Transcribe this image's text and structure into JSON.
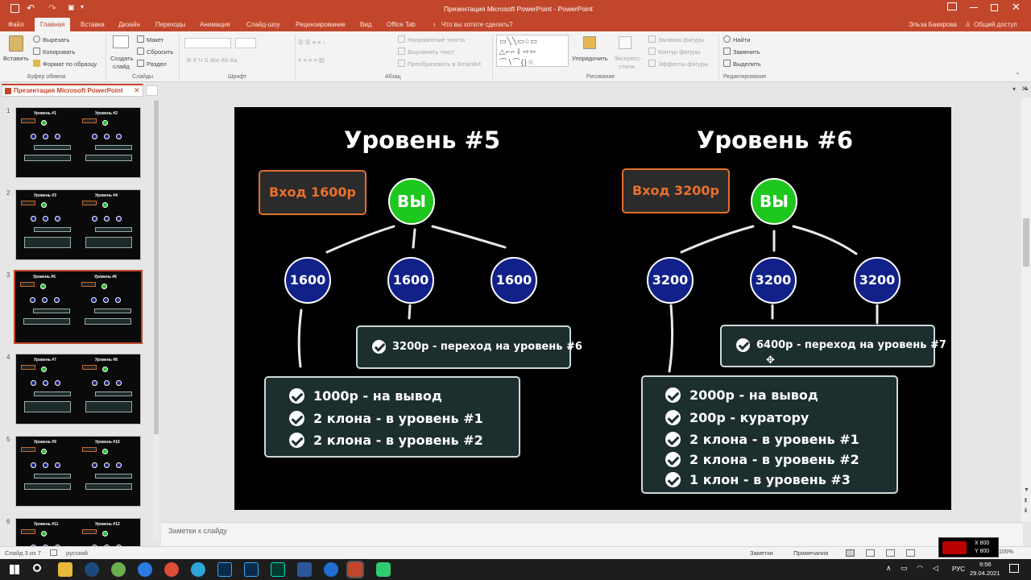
{
  "titlebar": {
    "title": "Презентация Microsoft PowerPoint - PowerPoint",
    "user": "Эльза Бакирова",
    "share": "Общий доступ"
  },
  "tabs": [
    "Файл",
    "Главная",
    "Вставка",
    "Дизайн",
    "Переходы",
    "Анимация",
    "Слайд-шоу",
    "Рецензирование",
    "Вид",
    "Office Tab"
  ],
  "tellme": "Что вы хотите сделать?",
  "ribbon": {
    "paste": "Вставить",
    "cut": "Вырезать",
    "copy": "Копировать",
    "format_painter": "Формат по образцу",
    "clipboard": "Буфер обмена",
    "new_slide_1": "Создать",
    "new_slide_2": "слайд",
    "layout": "Макет",
    "reset": "Сбросить",
    "section": "Раздел",
    "slides": "Слайды",
    "font_style": "Ж К Ч S abc AV Aa",
    "font": "Шрифт",
    "text_direction": "Направление текста",
    "align_text": "Выровнять текст",
    "smartart": "Преобразовать в SmartArt",
    "paragraph": "Абзац",
    "arrange": "Упорядочить",
    "quick_styles_1": "Экспресс-",
    "quick_styles_2": "стили",
    "shape_fill": "Заливка фигуры",
    "shape_outline": "Контур фигуры",
    "shape_effects": "Эффекты фигуры",
    "drawing": "Рисование",
    "find": "Найти",
    "replace": "Заменить",
    "select": "Выделить",
    "editing": "Редактирование"
  },
  "doc_tab": "Презентация Microsoft PowerPoint",
  "thumbnails": [
    {
      "num": "1",
      "left": "Уровень #1",
      "right": "Уровень #2"
    },
    {
      "num": "2",
      "left": "Уровень #3",
      "right": "Уровень #4"
    },
    {
      "num": "3",
      "left": "Уровень #5",
      "right": "Уровень #6"
    },
    {
      "num": "4",
      "left": "Уровень #7",
      "right": "Уровень #8"
    },
    {
      "num": "5",
      "left": "Уровень #9",
      "right": "Уровень #10"
    },
    {
      "num": "6",
      "left": "Уровень #11",
      "right": "Уровень #12"
    }
  ],
  "slide": {
    "left": {
      "title": "Уровень #5",
      "entry": "Вход 1600р",
      "you": "ВЫ",
      "nodes": [
        "1600",
        "1600",
        "1600"
      ],
      "transition": "3200р - переход на уровень #6",
      "rewards": [
        "1000р - на вывод",
        "2 клона - в уровень #1",
        "2 клона - в уровень #2"
      ]
    },
    "right": {
      "title": "Уровень #6",
      "entry": "Вход 3200р",
      "you": "ВЫ",
      "nodes": [
        "3200",
        "3200",
        "3200"
      ],
      "transition": "6400р - переход на уровень #7",
      "rewards": [
        "2000р - на вывод",
        "200р - куратору",
        "2 клона - в уровень #1",
        "2 клона - в уровень #2",
        "1 клон - в уровень #3"
      ]
    }
  },
  "notes_placeholder": "Заметки к слайду",
  "status": {
    "slide_of": "Слайд 3 из 7",
    "language": "русский",
    "notes": "Заметки",
    "comments": "Примечания",
    "zoom": "105%"
  },
  "overlay": {
    "x": "X 800",
    "y": "Y 800"
  },
  "taskbar": {
    "lang": "РУС",
    "time": "9:56",
    "date": "29.04.2021"
  },
  "colors": {
    "accent": "#c2462b",
    "you": "#1ec71e",
    "node": "#12218a",
    "entry": "#e8702b"
  }
}
